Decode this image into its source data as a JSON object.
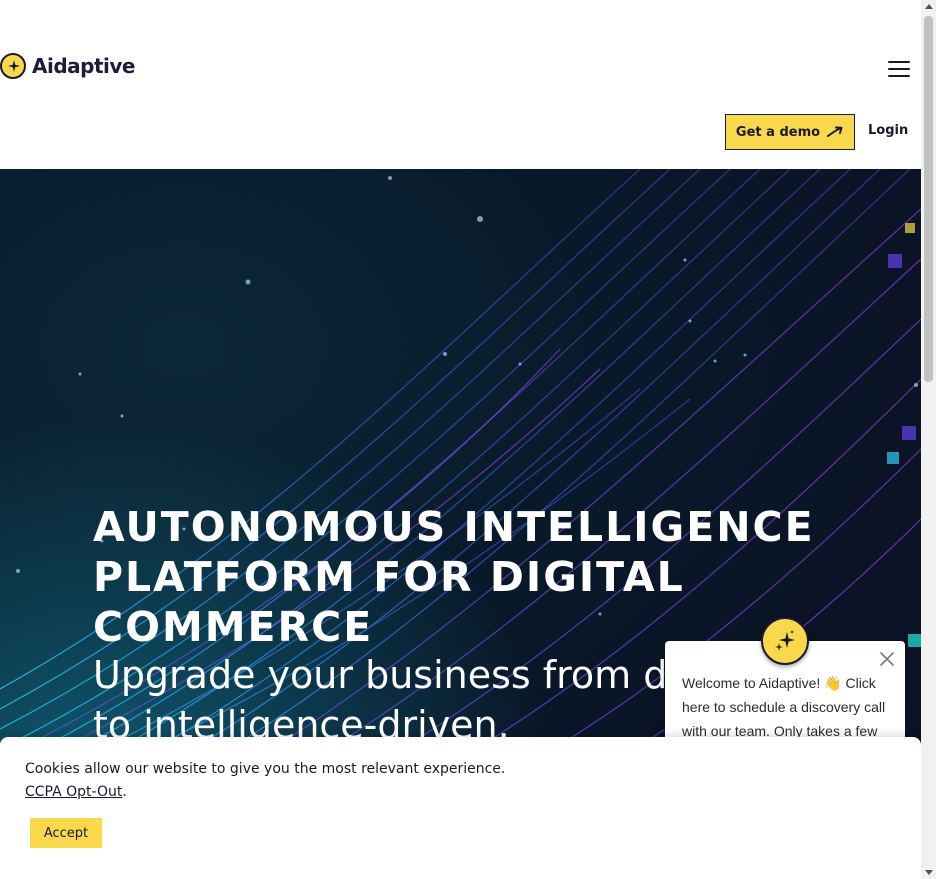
{
  "brand": {
    "name": "Aidaptive",
    "accent_color": "#f9d94b",
    "dark_color": "#1a1a2e"
  },
  "header": {
    "menu_icon": "hamburger-menu-icon",
    "demo_label": "Get a demo",
    "demo_icon": "arrow-up-right-icon",
    "login_label": "Login"
  },
  "hero": {
    "title": "AUTONOMOUS INTELLIGENCE PLATFORM FOR DIGITAL COMMERCE",
    "subtitle": "Upgrade your business from data-driven to intelligence-driven."
  },
  "chat": {
    "message": "Welcome to Aidaptive! 👋 Click here to schedule a discovery call with our team. Only takes a few",
    "close_icon": "close-icon",
    "avatar_icon": "sparkle-icon"
  },
  "cookie": {
    "message": "Cookies allow our website to give you the most relevant experience.",
    "link_label": "CCPA Opt-Out",
    "link_suffix": ".",
    "accept_label": "Accept"
  }
}
